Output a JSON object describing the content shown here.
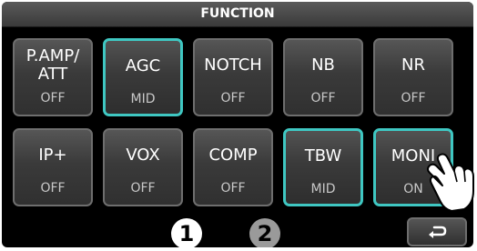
{
  "title": "FUNCTION",
  "buttons": [
    {
      "label": "P.AMP/\nATT",
      "value": "OFF",
      "active": false
    },
    {
      "label": "AGC",
      "value": "MID",
      "active": true
    },
    {
      "label": "NOTCH",
      "value": "OFF",
      "active": false
    },
    {
      "label": "NB",
      "value": "OFF",
      "active": false
    },
    {
      "label": "NR",
      "value": "OFF",
      "active": false
    },
    {
      "label": "IP+",
      "value": "OFF",
      "active": false
    },
    {
      "label": "VOX",
      "value": "OFF",
      "active": false
    },
    {
      "label": "COMP",
      "value": "OFF",
      "active": false
    },
    {
      "label": "TBW",
      "value": "MID",
      "active": true
    },
    {
      "label": "MONI",
      "value": "ON",
      "active": true
    }
  ],
  "pages": [
    "1",
    "2"
  ],
  "current_page": "1",
  "colors": {
    "active_border": "#3fc7c2",
    "background": "#000000"
  },
  "icons": {
    "return": "return-arrow-icon",
    "pointer": "pointing-hand-icon"
  }
}
